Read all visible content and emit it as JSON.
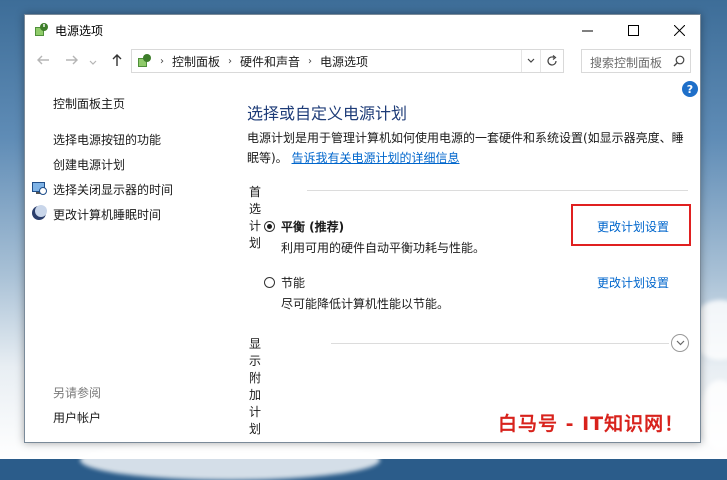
{
  "window": {
    "title": "电源选项",
    "icon": "power-options-icon"
  },
  "nav": {
    "back_icon": "arrow-left-icon",
    "forward_icon": "arrow-right-icon",
    "up_icon": "arrow-up-icon",
    "breadcrumb": [
      "控制面板",
      "硬件和声音",
      "电源选项"
    ],
    "search_placeholder": "搜索控制面板"
  },
  "sidebar": {
    "home": "控制面板主页",
    "links": [
      {
        "label": "选择电源按钮的功能"
      },
      {
        "label": "创建电源计划"
      },
      {
        "label": "选择关闭显示器的时间",
        "icon": "monitor-icon"
      },
      {
        "label": "更改计算机睡眠时间",
        "icon": "moon-icon"
      }
    ],
    "see_also": "另请参阅",
    "user_accounts": "用户帐户"
  },
  "main": {
    "heading": "选择或自定义电源计划",
    "description": "电源计划是用于管理计算机如何使用电源的一套硬件和系统设置(如显示器亮度、睡眠等)。",
    "description_link": "告诉我有关电源计划的详细信息",
    "preferred_title": "首选计划",
    "plans": [
      {
        "name": "平衡 (推荐)",
        "desc": "利用可用的硬件自动平衡功耗与性能。",
        "selected": true,
        "link": "更改计划设置"
      },
      {
        "name": "节能",
        "desc": "尽可能降低计算机性能以节能。",
        "selected": false,
        "link": "更改计划设置"
      }
    ],
    "additional_title": "显示附加计划"
  },
  "watermark": "白马号 - IT知识网！",
  "colors": {
    "heading": "#1e3c78",
    "link": "#0066cc",
    "highlight": "#e02020",
    "help": "#1e6fc9"
  }
}
